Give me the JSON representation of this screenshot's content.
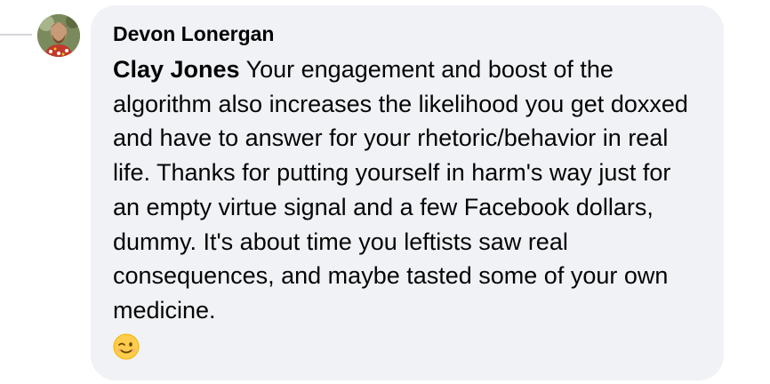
{
  "comment": {
    "author": "Devon Lonergan",
    "mention": "Clay Jones",
    "text": "Your engagement and boost of the algorithm also increases the likelihood you get doxxed and have to answer for your rhetoric/behavior in real life. Thanks for putting yourself in harm's way just for an empty virtue signal and a few Facebook dollars, dummy. It's about time you leftists saw real consequences, and maybe tasted some of your own medicine.",
    "emoji": "winking-face-emoji"
  },
  "colors": {
    "bubble_bg": "#f0f2f5",
    "text": "#050505",
    "thread_line": "#d3d6db"
  }
}
